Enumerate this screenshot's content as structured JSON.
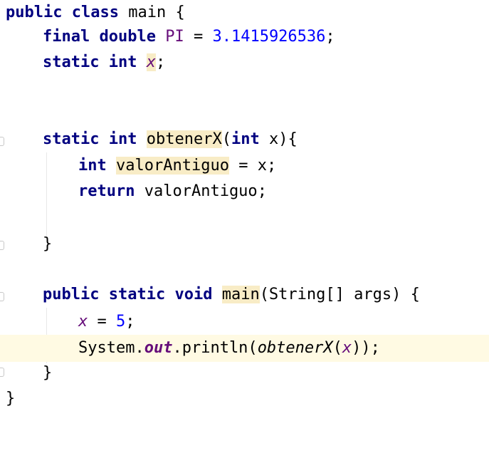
{
  "editor": {
    "language": "Java",
    "colors": {
      "keyword": "#000080",
      "number": "#0000ff",
      "field": "#660e7a",
      "current_line": "#fffae3",
      "usage_highlight": "#f8ecc6"
    },
    "lines": [
      "public class main {",
      "    final double PI = 3.1415926536;",
      "    static int x;",
      "",
      "",
      "    static int obtenerX(int x){",
      "        int valorAntiguo = x;",
      "        return valorAntiguo;",
      "",
      "    }",
      "",
      "    public static void main(String[] args) {",
      "        x = 5;",
      "        System.out.println(obtenerX(x));",
      "    }",
      "}"
    ],
    "tokens": {
      "public": "public",
      "class": "class",
      "class_name": "main",
      "open_brace": "{",
      "close_brace": "}",
      "final": "final",
      "double": "double",
      "pi": "PI",
      "assign": "=",
      "pi_value": "3.1415926536",
      "semicolon": ";",
      "static": "static",
      "int": "int",
      "x": "x",
      "method_name": "obtenerX",
      "open_paren": "(",
      "param_close": "){",
      "close_paren": ")",
      "local_var": "valorAntiguo",
      "return": "return",
      "void": "void",
      "main_name": "main",
      "main_params": "(String[] args) {",
      "five": "5",
      "system_dot": "System.",
      "out": "out",
      "println": ".println(",
      "call_close": "));"
    }
  }
}
